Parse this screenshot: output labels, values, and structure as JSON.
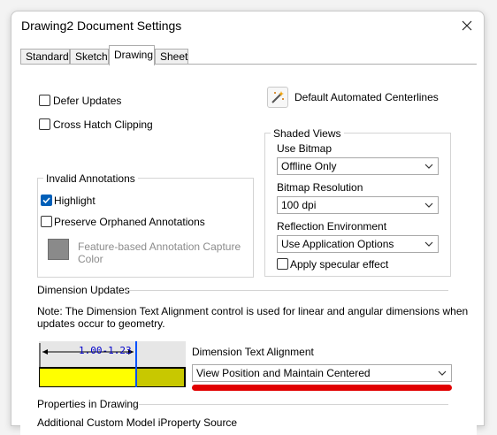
{
  "window": {
    "title": "Drawing2 Document Settings"
  },
  "tabs": [
    {
      "label": "Standard"
    },
    {
      "label": "Sketch"
    },
    {
      "label": "Drawing"
    },
    {
      "label": "Sheet"
    }
  ],
  "options": {
    "defer_updates": {
      "label": "Defer Updates",
      "checked": false
    },
    "cross_hatch_clipping": {
      "label": "Cross Hatch Clipping",
      "checked": false
    },
    "default_centerlines_label": "Default Automated Centerlines"
  },
  "invalid_annotations": {
    "title": "Invalid Annotations",
    "highlight": {
      "label": "Highlight",
      "checked": true
    },
    "preserve_orphaned": {
      "label": "Preserve Orphaned Annotations",
      "checked": false
    },
    "capture_color_label_1": "Feature-based Annotation Capture",
    "capture_color_label_2": "Color"
  },
  "shaded_views": {
    "title": "Shaded Views",
    "use_bitmap_label": "Use Bitmap",
    "use_bitmap_value": "Offline Only",
    "bitmap_resolution_label": "Bitmap Resolution",
    "bitmap_resolution_value": "100 dpi",
    "reflection_env_label": "Reflection Environment",
    "reflection_env_value": "Use Application Options",
    "specular": {
      "label": "Apply specular effect",
      "checked": false
    }
  },
  "dimension_updates": {
    "title": "Dimension Updates",
    "note_line1": "Note: The Dimension Text Alignment control is used for linear and angular dimensions when",
    "note_line2": "updates occur to geometry.",
    "preview_text": "1.00-1.23",
    "alignment_label": "Dimension Text Alignment",
    "alignment_value": "View Position and Maintain Centered"
  },
  "properties": {
    "title": "Properties in Drawing",
    "source_label": "Additional Custom Model iProperty Source"
  },
  "colors": {
    "accent": "#005fb8",
    "highlight_underline": "#e10000",
    "preview_yellow": "#ffff00",
    "preview_olive": "#c8c800"
  }
}
